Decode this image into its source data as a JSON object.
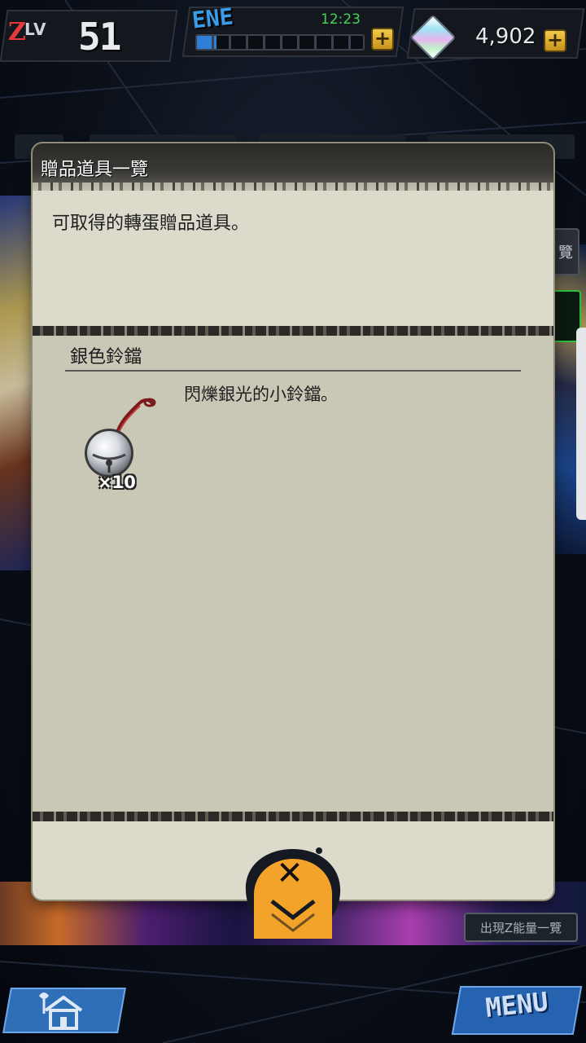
{
  "hud": {
    "level_prefix": "Z",
    "level_label": "LV",
    "level": "51",
    "energy_label": "ENE",
    "energy_timer": "12:23",
    "energy_fill_fraction": 0.12,
    "energy_plus": "+",
    "stones": "4,902",
    "stones_plus": "+"
  },
  "background": {
    "side_tab_text": "覽",
    "bottom_tab_text": "出現Z能量一覽"
  },
  "modal": {
    "title": "贈品道具一覽",
    "description": "可取得的轉蛋贈品道具。",
    "item": {
      "name": "銀色鈴鐺",
      "description": "閃爍銀光的小鈴鐺。",
      "quantity": "×10",
      "icon": "silver-bell-icon"
    },
    "close_glyph": "✕"
  },
  "nav": {
    "home_icon": "home-icon",
    "menu_label": "MENU"
  },
  "colors": {
    "panel": "#ceccbb",
    "energy": "#2f7fd6",
    "close_orange": "#f3a32a",
    "menu_blue": "#2563b0"
  }
}
